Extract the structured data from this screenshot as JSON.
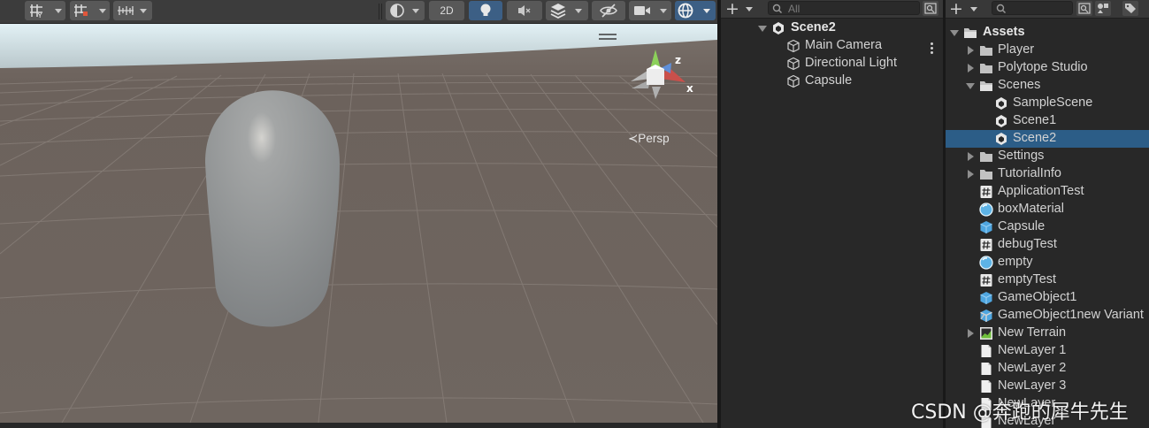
{
  "scene_view": {
    "toolbar": {
      "btn_2d_label": "2D"
    },
    "persp_label": "≺Persp",
    "gizmo_labels": {
      "z": "z",
      "x": "x"
    },
    "colors": {
      "sky": "#d9ecf2",
      "ground": "#6b615b",
      "capsule": "#8a8d8f"
    }
  },
  "hierarchy": {
    "search_placeholder": "All",
    "scene_name": "Scene2",
    "items": [
      {
        "label": "Main Camera"
      },
      {
        "label": "Directional Light"
      },
      {
        "label": "Capsule"
      }
    ]
  },
  "project": {
    "root": "Assets",
    "items": [
      {
        "label": "Player",
        "icon": "folder-icon",
        "arrow": "right"
      },
      {
        "label": "Polytope Studio",
        "icon": "folder-icon",
        "arrow": "right"
      },
      {
        "label": "Scenes",
        "icon": "folder-open-icon",
        "arrow": "down"
      },
      {
        "label": "SampleScene",
        "icon": "unity-scene-icon"
      },
      {
        "label": "Scene1",
        "icon": "unity-scene-icon"
      },
      {
        "label": "Scene2",
        "icon": "unity-scene-icon",
        "selected": true
      },
      {
        "label": "Settings",
        "icon": "folder-icon",
        "arrow": "right"
      },
      {
        "label": "TutorialInfo",
        "icon": "folder-icon",
        "arrow": "right"
      },
      {
        "label": "ApplicationTest",
        "icon": "csharp-script-icon"
      },
      {
        "label": "boxMaterial",
        "icon": "material-icon"
      },
      {
        "label": "Capsule",
        "icon": "prefab-icon"
      },
      {
        "label": "debugTest",
        "icon": "csharp-script-icon"
      },
      {
        "label": "empty",
        "icon": "material-icon"
      },
      {
        "label": "emptyTest",
        "icon": "csharp-script-icon"
      },
      {
        "label": "GameObject1",
        "icon": "prefab-icon"
      },
      {
        "label": "GameObject1new Variant",
        "icon": "prefab-variant-icon"
      },
      {
        "label": "New Terrain",
        "icon": "terrain-icon",
        "arrow": "right"
      },
      {
        "label": "NewLayer 1",
        "icon": "file-icon"
      },
      {
        "label": "NewLayer 2",
        "icon": "file-icon"
      },
      {
        "label": "NewLayer 3",
        "icon": "file-icon"
      },
      {
        "label": "NewLayer",
        "icon": "file-icon"
      },
      {
        "label": "NewLayer",
        "icon": "file-icon"
      }
    ],
    "selected_color": "#2c5d87"
  },
  "watermark": "CSDN @奔跑的犀牛先生"
}
